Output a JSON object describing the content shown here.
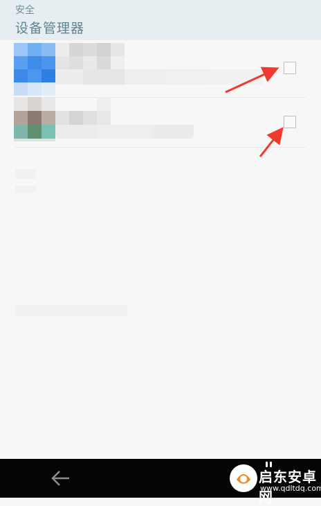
{
  "header": {
    "breadcrumb": "安全",
    "title": "设备管理器"
  },
  "device_admin_list": {
    "items": [
      {
        "checked": false
      },
      {
        "checked": false
      }
    ]
  },
  "nav": {
    "back_icon": "back-arrow-icon"
  },
  "watermark": {
    "text": "启东安卓网",
    "url": "www.qdltdq.com"
  },
  "colors": {
    "header_bg": "#e7eef1",
    "header_text": "#5f848f",
    "annotation_arrow": "#f03a2e",
    "navbar_bg": "#050505"
  }
}
